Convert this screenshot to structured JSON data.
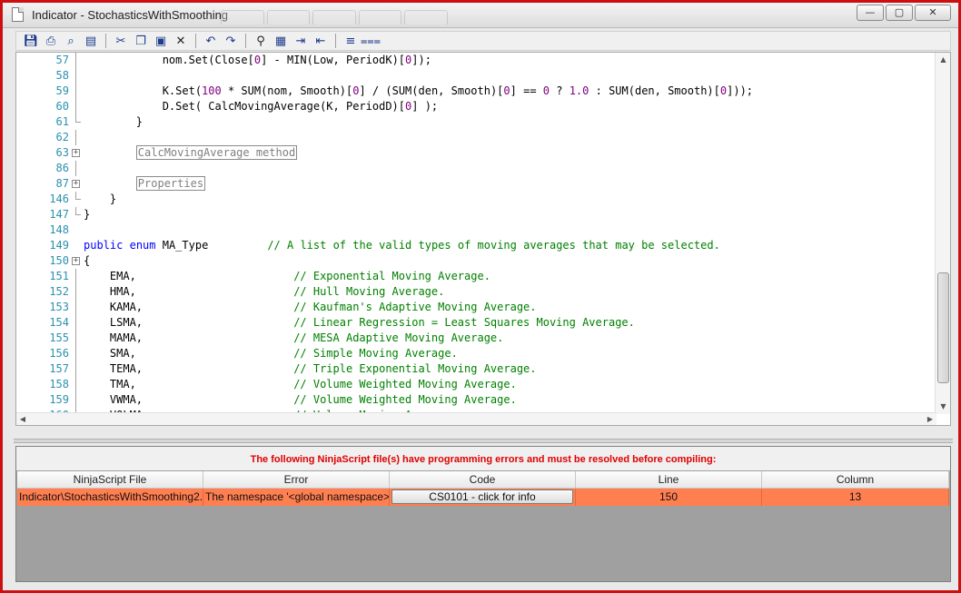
{
  "window": {
    "title": "Indicator - StochasticsWithSmoothing",
    "buttons": {
      "minimize": "—",
      "maximize": "▢",
      "close": "✕"
    }
  },
  "toolbar": {
    "icons": [
      "save-icon",
      "print-icon",
      "print-preview-icon",
      "page-setup-icon",
      "cut-icon",
      "copy-icon",
      "paste-icon",
      "delete-icon",
      "undo-icon",
      "redo-icon",
      "find-icon",
      "find-replace-icon",
      "indent-icon",
      "outdent-icon",
      "comment-icon",
      "uncomment-icon"
    ]
  },
  "editor": {
    "lines": [
      {
        "n": "57",
        "fold": "line",
        "html": "            nom.Set(Close[<span class=\"num\">0</span>] - MIN(Low, PeriodK)[<span class=\"num\">0</span>]);"
      },
      {
        "n": "58",
        "fold": "line",
        "html": ""
      },
      {
        "n": "59",
        "fold": "line",
        "html": "            K.Set(<span class=\"num\">100</span> * SUM(nom, Smooth)[<span class=\"num\">0</span>] / (SUM(den, Smooth)[<span class=\"num\">0</span>] == <span class=\"num\">0</span> ? <span class=\"num\">1.0</span> : SUM(den, Smooth)[<span class=\"num\">0</span>]));"
      },
      {
        "n": "60",
        "fold": "line",
        "html": "            D.Set( CalcMovingAverage(K, PeriodD)[<span class=\"num\">0</span>] );"
      },
      {
        "n": "61",
        "fold": "end",
        "html": "        }"
      },
      {
        "n": "62",
        "fold": "line",
        "html": ""
      },
      {
        "n": "63",
        "fold": "box",
        "html": "        <span class=\"collapsed\">CalcMovingAverage method</span>"
      },
      {
        "n": "86",
        "fold": "line",
        "html": ""
      },
      {
        "n": "87",
        "fold": "box",
        "html": "        <span class=\"collapsed\">Properties</span>"
      },
      {
        "n": "146",
        "fold": "end",
        "html": "    }"
      },
      {
        "n": "147",
        "fold": "end",
        "html": "}"
      },
      {
        "n": "148",
        "fold": "",
        "html": ""
      },
      {
        "n": "149",
        "fold": "",
        "html": "<span class=\"kw\">public</span> <span class=\"kw\">enum</span> MA_Type         <span class=\"cm\">// A list of the valid types of moving averages that may be selected.</span>"
      },
      {
        "n": "150",
        "fold": "box",
        "html": "{"
      },
      {
        "n": "151",
        "fold": "line",
        "html": "    EMA,                        <span class=\"cm\">// Exponential Moving Average.</span>"
      },
      {
        "n": "152",
        "fold": "line",
        "html": "    HMA,                        <span class=\"cm\">// Hull Moving Average.</span>"
      },
      {
        "n": "153",
        "fold": "line",
        "html": "    KAMA,                       <span class=\"cm\">// Kaufman's Adaptive Moving Average.</span>"
      },
      {
        "n": "154",
        "fold": "line",
        "html": "    LSMA,                       <span class=\"cm\">// Linear Regression = Least Squares Moving Average.</span>"
      },
      {
        "n": "155",
        "fold": "line",
        "html": "    MAMA,                       <span class=\"cm\">// MESA Adaptive Moving Average.</span>"
      },
      {
        "n": "156",
        "fold": "line",
        "html": "    SMA,                        <span class=\"cm\">// Simple Moving Average.</span>"
      },
      {
        "n": "157",
        "fold": "line",
        "html": "    TEMA,                       <span class=\"cm\">// Triple Exponential Moving Average.</span>"
      },
      {
        "n": "158",
        "fold": "line",
        "html": "    TMA,                        <span class=\"cm\">// Volume Weighted Moving Average.</span>"
      },
      {
        "n": "159",
        "fold": "line",
        "html": "    VWMA,                       <span class=\"cm\">// Volume Weighted Moving Average.</span>"
      },
      {
        "n": "160",
        "fold": "line",
        "html": "    VOLMA,                      <span class=\"cm\">// Volume Moving Average.</span>"
      }
    ]
  },
  "errors": {
    "message": "The following NinjaScript file(s) have programming errors and must be resolved before compiling:",
    "columns": [
      "NinjaScript File",
      "Error",
      "Code",
      "Line",
      "Column"
    ],
    "rows": [
      {
        "file": "Indicator\\StochasticsWithSmoothing2.",
        "error": "The namespace '<global namespace>'",
        "code": "CS0101 - click for info",
        "line": "150",
        "column": "13"
      }
    ],
    "row_color": "#ff7f50"
  }
}
